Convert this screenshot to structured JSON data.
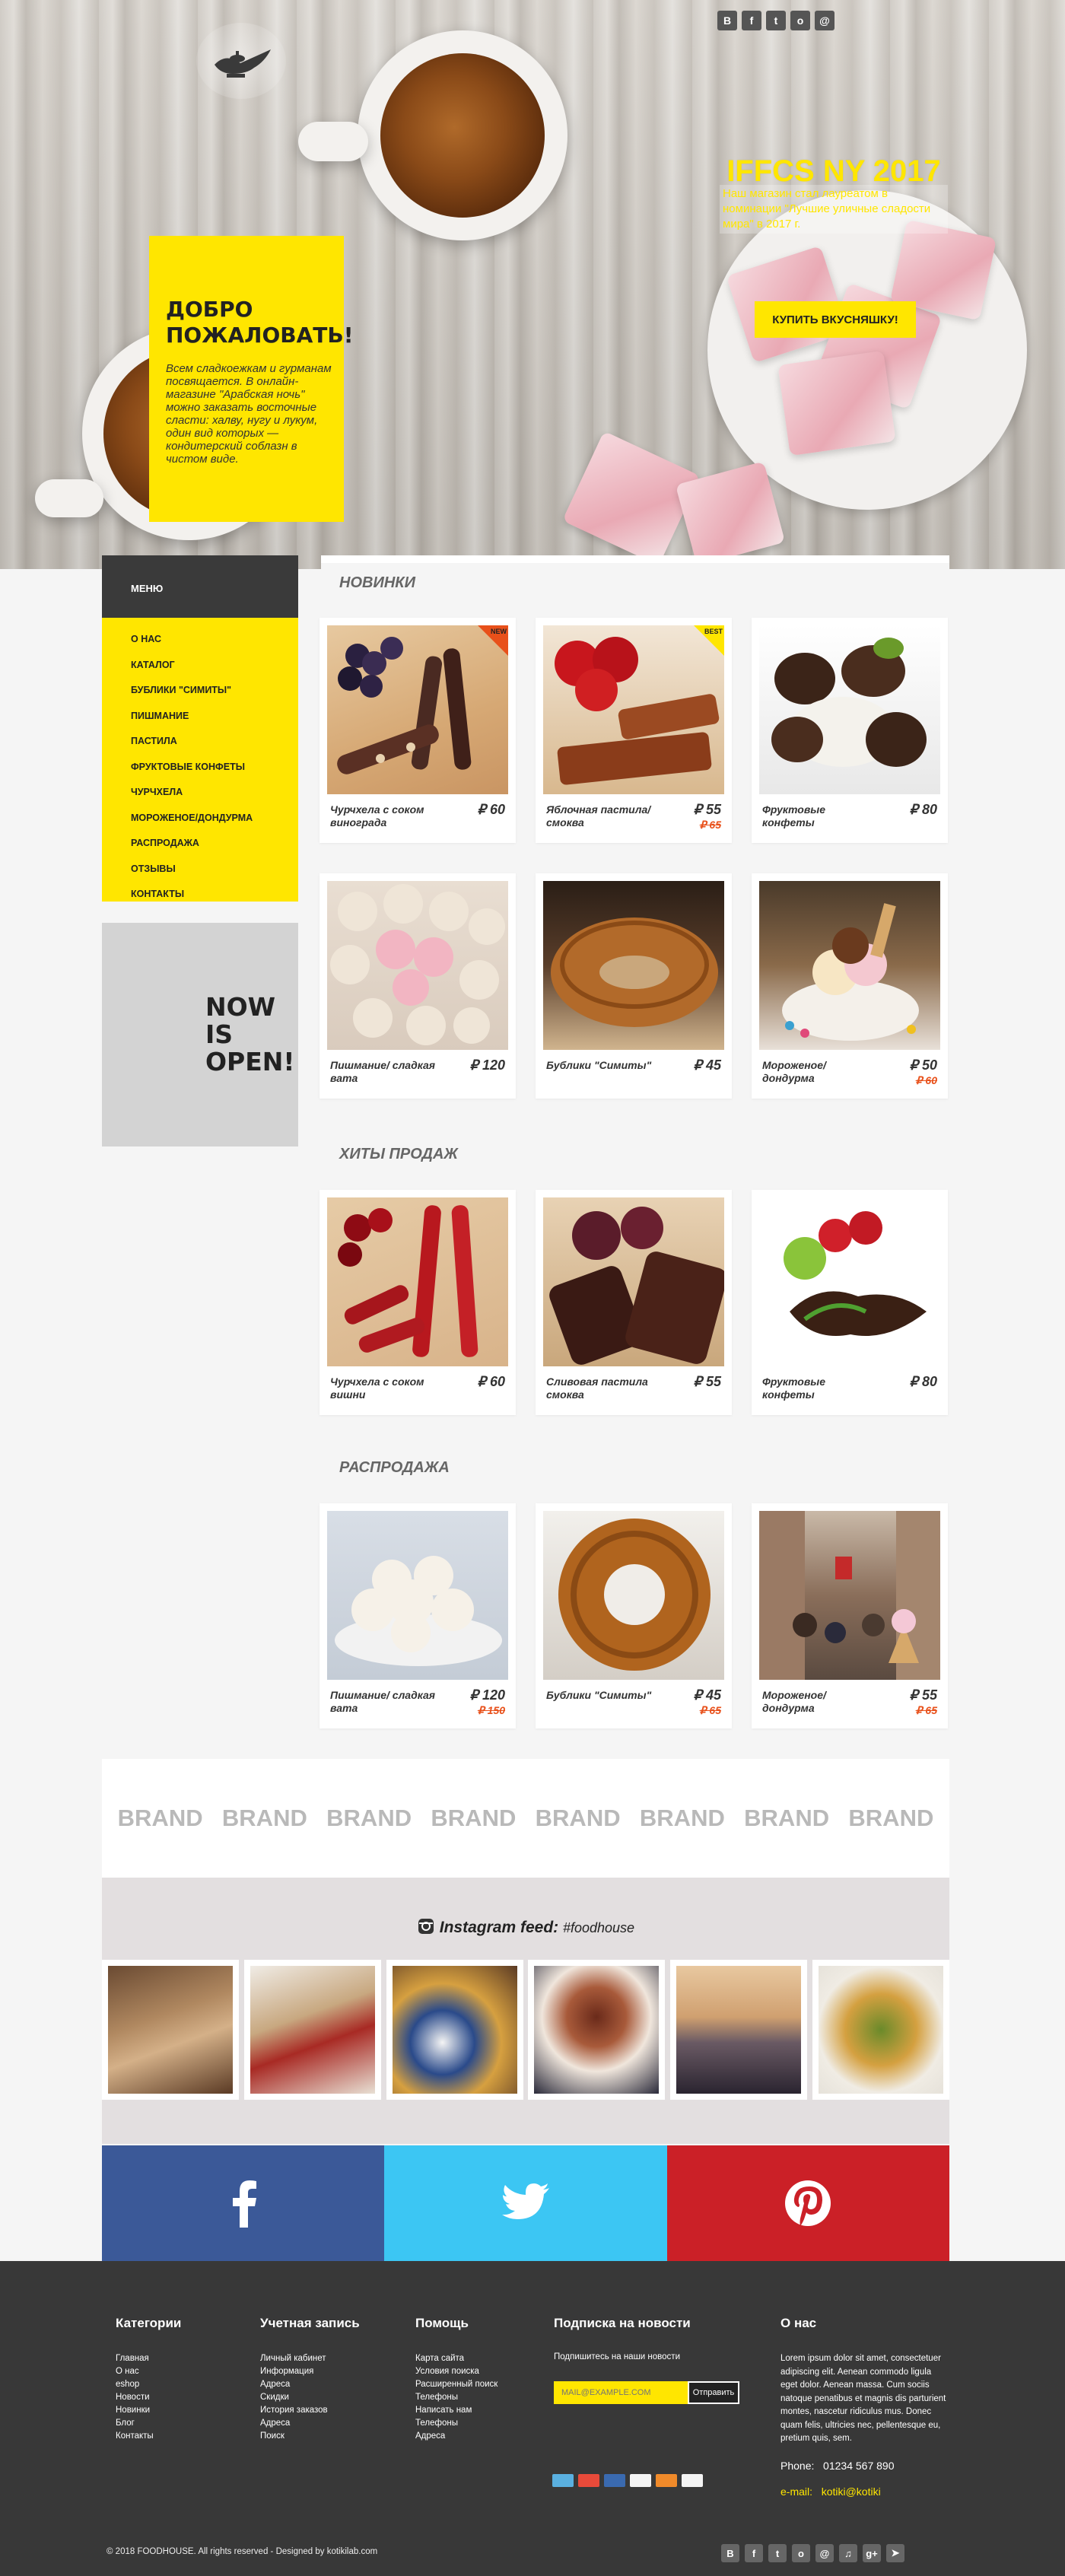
{
  "header": {
    "logo_icon": "magic-lamp-icon",
    "social_icons": [
      "vk-icon",
      "facebook-icon",
      "twitter-icon",
      "odnoklassniki-icon",
      "email-icon"
    ],
    "social_glyphs": [
      "В",
      "f",
      "t",
      "o",
      "@"
    ]
  },
  "welcome": {
    "title": "ДОБРО ПОЖАЛОВАТЬ!",
    "text": "Всем сладкоежкам и гурманам посвящается. В онлайн-магазине \"Арабская ночь\" можно заказать восточные сласти: халву, нугу и лукум, один вид которых — кондитерский соблазн в чистом виде."
  },
  "promo": {
    "title": "IFFCS NY 2017",
    "text": "Наш магазин стал лауреатом в номинации \"Лучшие уличные сладости мира\" в 2017 г.",
    "button": "КУПИТЬ ВКУСНЯШКУ!"
  },
  "menu": {
    "title": "МЕНЮ",
    "items": [
      "О НАС",
      "КАТАЛОГ",
      "БУБЛИКИ \"СИМИТЫ\"",
      "ПИШМАНИЕ",
      "ПАСТИЛА",
      "ФРУКТОВЫЕ КОНФЕТЫ",
      "ЧУРЧХЕЛА",
      "МОРОЖЕНОЕ/ДОНДУРМА",
      "РАСПРОДАЖА",
      "ОТЗЫВЫ",
      "КОНТАКТЫ"
    ]
  },
  "open_sign": [
    "NOW",
    "IS",
    "OPEN!"
  ],
  "sections": {
    "new": {
      "title": "НОВИНКИ",
      "products": [
        {
          "name": "Чурчхела с соком винограда",
          "price": "₽ 60",
          "old": "",
          "badge": "NEW",
          "badge_color": "#e8501a",
          "icon": "churchkhela-grape-image"
        },
        {
          "name": "Яблочная пастила/ смоква",
          "price": "₽ 55",
          "old": "₽ 65",
          "badge": "BEST",
          "badge_color": "#ffe600",
          "icon": "apple-pastila-image"
        },
        {
          "name": "Фруктовые конфеты",
          "price": "₽ 80",
          "old": "",
          "badge": "",
          "badge_color": "",
          "icon": "fruit-candy-image"
        },
        {
          "name": "Пишмание/ сладкая вата",
          "price": "₽ 120",
          "old": "",
          "badge": "",
          "badge_color": "",
          "icon": "pishmaniye-image"
        },
        {
          "name": "Бублики \"Симиты\"",
          "price": "₽ 45",
          "old": "",
          "badge": "",
          "badge_color": "",
          "icon": "simit-image"
        },
        {
          "name": "Мороженое/ дондурма",
          "price": "₽ 50",
          "old": "₽ 60",
          "badge": "",
          "badge_color": "",
          "icon": "ice-cream-image"
        }
      ]
    },
    "hits": {
      "title": "ХИТЫ ПРОДАЖ",
      "products": [
        {
          "name": "Чурчхела с соком вишни",
          "price": "₽ 60",
          "old": "",
          "icon": "churchkhela-cherry-image"
        },
        {
          "name": "Сливовая пастила смоква",
          "price": "₽ 55",
          "old": "",
          "icon": "plum-pastila-image"
        },
        {
          "name": "Фруктовые конфеты",
          "price": "₽ 80",
          "old": "",
          "icon": "chocolate-strawberry-image"
        }
      ]
    },
    "sale": {
      "title": "РАСПРОДАЖА",
      "products": [
        {
          "name": "Пишмание/ сладкая вата",
          "price": "₽ 120",
          "old": "₽ 150",
          "icon": "pishmaniye-sale-image"
        },
        {
          "name": "Бублики \"Симиты\"",
          "price": "₽ 45",
          "old": "₽ 65",
          "icon": "simit-sale-image"
        },
        {
          "name": "Мороженое/ дондурма",
          "price": "₽ 55",
          "old": "₽ 65",
          "icon": "street-ice-cream-image"
        }
      ]
    }
  },
  "brands": [
    "BRAND",
    "BRAND",
    "BRAND",
    "BRAND",
    "BRAND",
    "BRAND",
    "BRAND",
    "BRAND"
  ],
  "instagram": {
    "title": "Instagram feed:",
    "tag": "#foodhouse",
    "icon": "instagram-icon",
    "photos": [
      "turkish-tea-set-photo",
      "tea-pouring-photo",
      "tea-breakfast-photo",
      "spice-market-photo",
      "bosphorus-tea-photo",
      "baklava-photo"
    ]
  },
  "social_bar": [
    {
      "icon": "facebook-icon",
      "color": "#3b5998"
    },
    {
      "icon": "twitter-icon",
      "color": "#3cc6f3"
    },
    {
      "icon": "pinterest-icon",
      "color": "#cb2027"
    }
  ],
  "footer": {
    "categories": {
      "title": "Категории",
      "items": [
        "Главная",
        "О нас",
        "eshop",
        "Новости",
        "Новинки",
        "Блог",
        "Контакты"
      ]
    },
    "account": {
      "title": "Учетная запись",
      "items": [
        "Личный кабинет",
        "Информация",
        "Адреса",
        "Скидки",
        "История заказов",
        "Адреса",
        "Поиск"
      ]
    },
    "help": {
      "title": "Помощь",
      "items": [
        "Карта сайта",
        "Условия поиска",
        "Расширенный поиск",
        "Телефоны",
        "Написать нам",
        "Телефоны",
        "Адреса"
      ]
    },
    "subscribe": {
      "title": "Подписка на новости",
      "label": "Подпишитесь на наши новости",
      "placeholder": "MAIL@EXAMPLE.COM",
      "button": "Отправить"
    },
    "payments": [
      "amex-icon",
      "mastercard-icon",
      "maestro-icon",
      "paypal-icon",
      "discover-icon",
      "visa-icon"
    ],
    "about": {
      "title": "О нас",
      "text": "Lorem ipsum dolor sit amet, consectetuer adipiscing elit. Aenean commodo ligula eget dolor. Aenean massa. Cum sociis natoque penatibus et magnis dis parturient montes, nascetur ridiculus mus. Donec quam felis, ultricies nec, pellentesque eu, pretium quis, sem.",
      "phone_label": "Phone:",
      "phone": "01234 567 890",
      "email_label": "e-mail:",
      "email": "kotiki@kotiki"
    },
    "copyright": "© 2018 FOODHOUSE. All rights reserved - Designed by kotikilab.com",
    "social_icons": [
      "vk-icon",
      "facebook-icon",
      "twitter-icon",
      "odnoklassniki-icon",
      "email-icon",
      "lastfm-icon",
      "google-plus-icon",
      "telegram-icon"
    ],
    "social_glyphs": [
      "В",
      "f",
      "t",
      "o",
      "@",
      "♫",
      "g+",
      "➤"
    ]
  }
}
